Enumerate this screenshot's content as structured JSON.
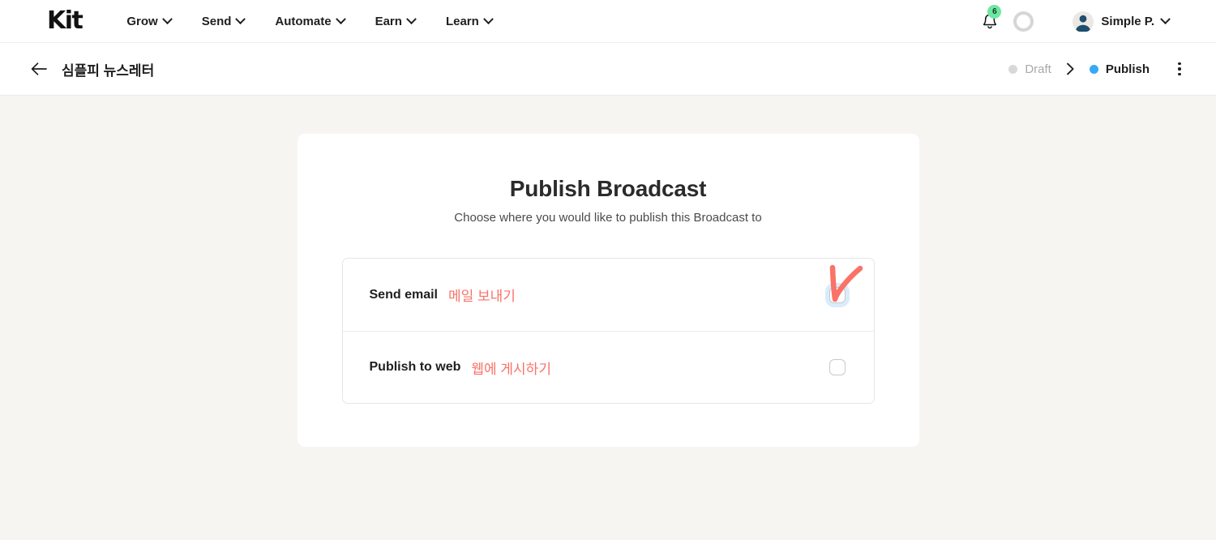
{
  "brand": {
    "logo_text": "Kit"
  },
  "topnav": {
    "items": [
      {
        "label": "Grow",
        "icon": "chevron-down-icon"
      },
      {
        "label": "Send",
        "icon": "chevron-down-icon"
      },
      {
        "label": "Automate",
        "icon": "chevron-down-icon"
      },
      {
        "label": "Earn",
        "icon": "chevron-down-icon"
      },
      {
        "label": "Learn",
        "icon": "chevron-down-icon"
      }
    ],
    "notifications": {
      "icon": "bell-icon",
      "badge_count": "6",
      "badge_color": "#6ee7a1"
    },
    "progress_ring": {
      "icon": "progress-ring-icon",
      "color": "#d6d6d6"
    },
    "account": {
      "name": "Simple P.",
      "icon": "avatar-icon",
      "caret": "chevron-down-icon"
    }
  },
  "titlebar": {
    "back_icon": "arrow-left-icon",
    "title": "심플피 뉴스레터",
    "steps": [
      {
        "label": "Draft",
        "state": "inactive",
        "dot_color": "#d8d8d8"
      },
      {
        "label": "Publish",
        "state": "active",
        "dot_color": "#38a8f8"
      }
    ],
    "separator_icon": "chevron-right-icon",
    "menu_icon": "kebab-menu-icon"
  },
  "main": {
    "card": {
      "title": "Publish Broadcast",
      "subtitle": "Choose where you would like to publish this Broadcast to",
      "options": [
        {
          "label": "Send email",
          "annotation_ko": "메일 보내기",
          "checkbox": {
            "checked": false,
            "focused": true
          },
          "has_drawn_check": true
        },
        {
          "label": "Publish to web",
          "annotation_ko": "웹에 게시하기",
          "checkbox": {
            "checked": false,
            "focused": false
          },
          "has_drawn_check": false
        }
      ]
    }
  },
  "colors": {
    "page_background": "#f7f5f2",
    "surface": "#ffffff",
    "annotation_red": "#fa7268",
    "accent_blue": "#38a8f8",
    "badge_green": "#6ee7a1"
  }
}
